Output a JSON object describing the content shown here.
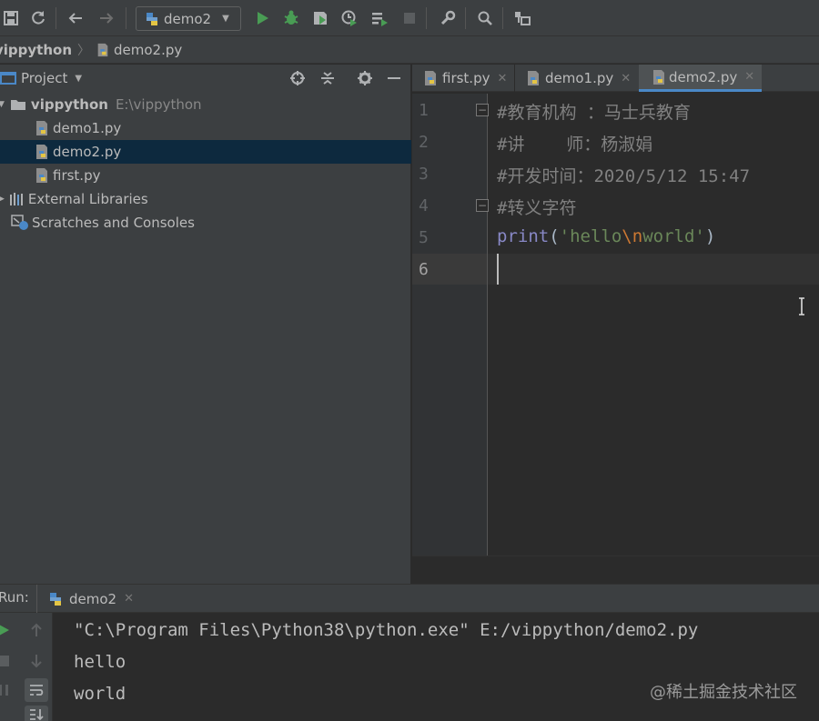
{
  "toolbar": {
    "run_config": "demo2",
    "icons": [
      "save-icon",
      "sync-icon",
      "back-icon",
      "forward-icon",
      "run-icon",
      "debug-icon",
      "coverage-icon",
      "profile-icon",
      "run-build-icon",
      "stop-icon",
      "wrench-icon",
      "search-icon",
      "structure-icon"
    ]
  },
  "breadcrumb": {
    "project": "vippython",
    "file": "demo2.py"
  },
  "project_panel": {
    "title": "Project",
    "tree": [
      {
        "label": "vippython",
        "path": "E:\\vippython"
      },
      {
        "label": "demo1.py"
      },
      {
        "label": "demo2.py"
      },
      {
        "label": "first.py"
      },
      {
        "label": "External Libraries"
      },
      {
        "label": "Scratches and Consoles"
      }
    ]
  },
  "editor": {
    "tabs": [
      {
        "label": "first.py"
      },
      {
        "label": "demo1.py"
      },
      {
        "label": "demo2.py"
      }
    ],
    "line_numbers": [
      "1",
      "2",
      "3",
      "4",
      "5",
      "6"
    ],
    "lines": {
      "l1": "#教育机构 ：马士兵教育",
      "l2": "#讲    师：杨淑娟",
      "l3": "#开发时间：2020/5/12 15:47",
      "l4": "#转义字符",
      "l5_func": "print",
      "l5_open": "(",
      "l5_str_a": "'hello",
      "l5_esc": "\\n",
      "l5_str_b": "world'",
      "l5_close": ")"
    }
  },
  "run_panel": {
    "label": "Run:",
    "tab": "demo2",
    "output": [
      "\"C:\\Program Files\\Python38\\python.exe\" E:/vippython/demo2.py",
      "hello",
      "world"
    ]
  },
  "watermark": "@稀土掘金技术社区",
  "colors": {
    "background": "#2b2b2b",
    "panel": "#3c3f41",
    "selection": "#0d293e",
    "accent": "#4a88c7",
    "comment": "#808080",
    "string": "#6a8759",
    "escape": "#cc7832",
    "builtin": "#8888c6"
  }
}
